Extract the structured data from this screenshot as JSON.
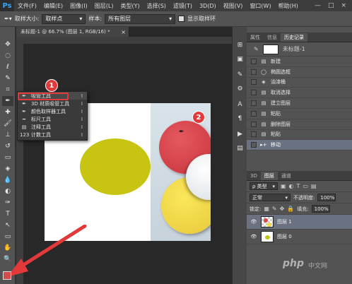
{
  "app": {
    "logo": "Ps"
  },
  "menubar": {
    "items": [
      "文件(F)",
      "编辑(E)",
      "图像(I)",
      "图层(L)",
      "类型(Y)",
      "选择(S)",
      "滤镜(T)",
      "3D(D)",
      "视图(V)",
      "窗口(W)",
      "帮助(H)"
    ],
    "window_controls": [
      "—",
      "□",
      "×"
    ]
  },
  "options": {
    "sample_size_label": "取样大小:",
    "sample_size_value": "取样点",
    "sample_label": "样本:",
    "sample_value": "所有图层",
    "show_ring_label": "显示取样环"
  },
  "document": {
    "tab_title": "未标题-1 @ 66.7% (图层 1, RGB/16) *",
    "close": "×"
  },
  "flyout": {
    "items": [
      {
        "label": "吸管工具",
        "key": "I",
        "icon": "✒"
      },
      {
        "label": "3D 材质吸管工具",
        "key": "I",
        "icon": "✒"
      },
      {
        "label": "颜色取样器工具",
        "key": "I",
        "icon": "✒"
      },
      {
        "label": "标尺工具",
        "key": "I",
        "icon": "━"
      },
      {
        "label": "注释工具",
        "key": "I",
        "icon": "▤"
      },
      {
        "label": "计数工具",
        "key": "I",
        "icon": "123"
      }
    ]
  },
  "annotations": {
    "badge1": "1",
    "badge2": "2",
    "accent": "#e23a3a"
  },
  "colors": {
    "foreground": "#d44b4b",
    "ellipse": "#c8c412"
  },
  "panels": {
    "top_tabs": [
      "属性",
      "信息",
      "历史记录"
    ],
    "history": {
      "snapshot_label": "未标题-1",
      "items": [
        "新建",
        "椭圆选框",
        "油漆桶",
        "取消选择",
        "建立图层",
        "粘贴",
        "删除图层",
        "粘贴",
        "移动"
      ]
    },
    "layers": {
      "tabs": [
        "3D",
        "图层",
        "通道"
      ],
      "kind_label": "ρ 类型",
      "blend_mode": "正常",
      "opacity_label": "不透明度:",
      "opacity_value": "100%",
      "lock_label": "锁定:",
      "fill_label": "填充:",
      "fill_value": "100%",
      "items": [
        {
          "name": "图层 1",
          "active": true
        },
        {
          "name": "图层 0",
          "active": false
        }
      ]
    }
  },
  "watermark": {
    "text": "php",
    "cn": "中文网"
  }
}
